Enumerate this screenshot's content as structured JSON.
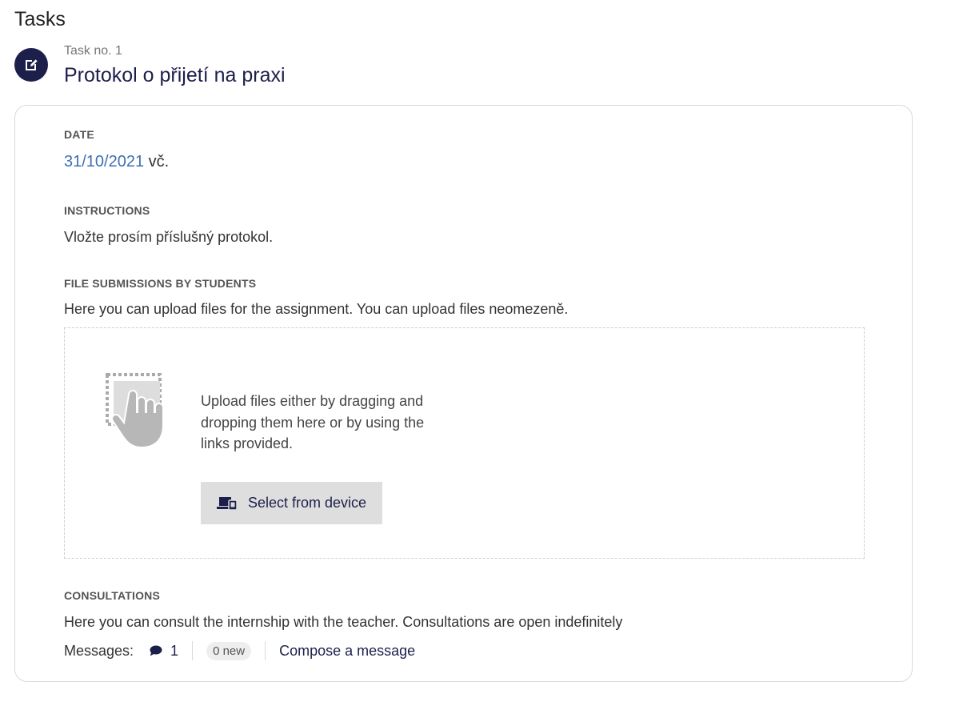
{
  "page": {
    "title": "Tasks"
  },
  "task": {
    "number_label": "Task no. 1",
    "title": "Protokol o přijetí na praxi",
    "icon": "edit-icon"
  },
  "date": {
    "label": "DATE",
    "value": "31/10/2021",
    "suffix": " vč."
  },
  "instructions": {
    "label": "INSTRUCTIONS",
    "text": "Vložte prosím příslušný protokol."
  },
  "submissions": {
    "label": "FILE SUBMISSIONS BY STUDENTS",
    "text": "Here you can upload files for the assignment. You can upload files neomezeně.",
    "dropzone_text": "Upload files either by dragging and dropping them here or by using the links provided.",
    "select_button_label": "Select from device",
    "select_button_icon": "devices-icon",
    "illustration_icon": "drag-drop-hand-icon"
  },
  "consultations": {
    "label": "CONSULTATIONS",
    "text": "Here you can consult the internship with the teacher. Consultations are open indefinitely",
    "messages_label": "Messages:",
    "message_count": "1",
    "message_icon": "chat-bubble-icon",
    "new_badge": "0 new",
    "compose_label": "Compose a message"
  },
  "colors": {
    "accent": "#1d1f4b",
    "link": "#3e6fb4",
    "button_bg": "#dedede",
    "border": "#d9d9d9"
  }
}
